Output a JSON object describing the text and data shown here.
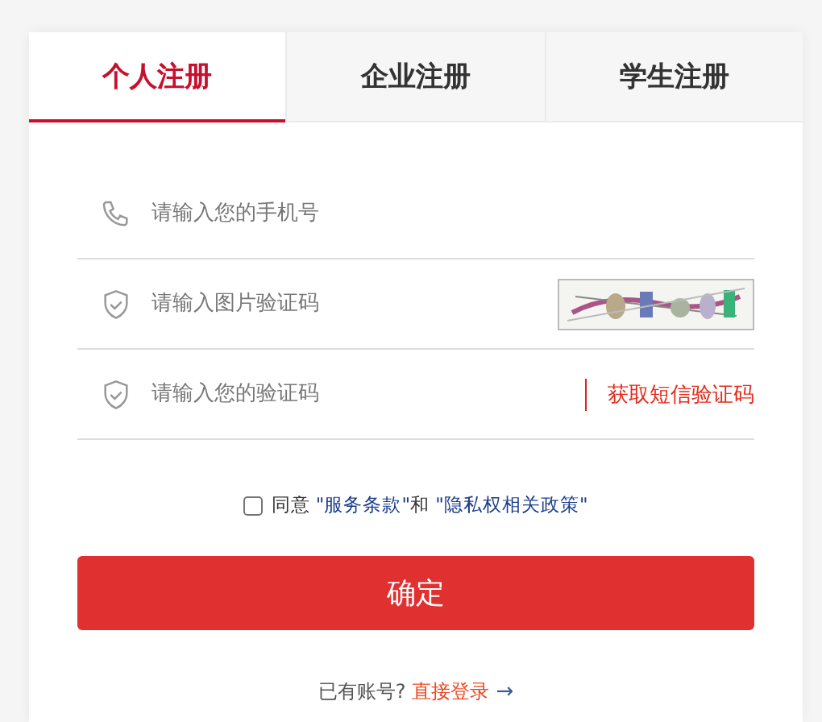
{
  "tabs": [
    {
      "label": "个人注册",
      "selected": true
    },
    {
      "label": "企业注册",
      "selected": false
    },
    {
      "label": "学生注册",
      "selected": false
    }
  ],
  "fields": [
    {
      "kind": "phone",
      "placeholder": "请输入您的手机号"
    },
    {
      "kind": "captcha",
      "placeholder": "请输入图片验证码"
    },
    {
      "kind": "sms",
      "placeholder": "请输入您的验证码",
      "action": "获取短信验证码"
    }
  ],
  "agreement": {
    "checked": false,
    "parts": [
      {
        "kind": "text",
        "text": "同意 "
      },
      {
        "kind": "link",
        "text": "\"服务条款\""
      },
      {
        "kind": "text",
        "text": "和 "
      },
      {
        "kind": "link",
        "text": "\"隐私权相关政策\""
      }
    ]
  },
  "submit": "确定",
  "login": {
    "prompt": "已有账号?",
    "link": "直接登录",
    "arrow": "→"
  }
}
